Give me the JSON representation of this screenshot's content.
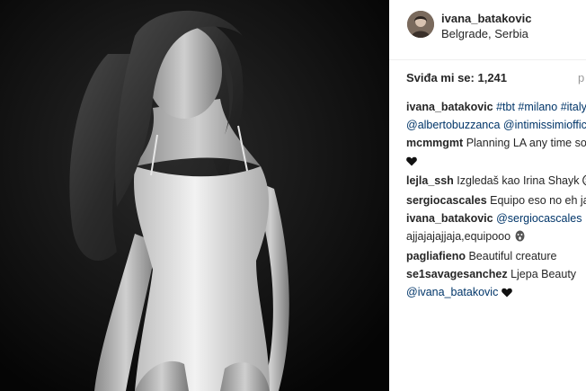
{
  "post": {
    "username": "ivana_batakovic",
    "location": "Belgrade, Serbia",
    "likes_label": "Sviđa mi se: 1,241",
    "date_partial": "p"
  },
  "comments": [
    {
      "user": "ivana_batakovic",
      "parts": [
        " ",
        {
          "link": "#tbt"
        },
        " ",
        {
          "link": "#milano"
        },
        " ",
        {
          "link": "#italy"
        }
      ]
    },
    {
      "user": "",
      "parts": [
        {
          "link": "@albertobuzzanca"
        },
        " ",
        {
          "link": "@intimissimiofficial"
        }
      ]
    },
    {
      "user": "mcmmgmt",
      "parts": [
        " Planning LA any time soon"
      ]
    },
    {
      "user": "",
      "parts": [
        {
          "emoji": "black-heart"
        }
      ]
    },
    {
      "user": "lejla_ssh",
      "parts": [
        " Izgledaš kao Irina Shayk ",
        {
          "emoji": "smile"
        }
      ]
    },
    {
      "user": "sergiocascales",
      "parts": [
        " Equipo eso no eh jajaja"
      ]
    },
    {
      "user": "ivana_batakovic",
      "parts": [
        " ",
        {
          "link": "@sergiocascales"
        }
      ]
    },
    {
      "user": "",
      "parts": [
        "ajjajajajjaja,equipooo ",
        {
          "emoji": "scream"
        }
      ]
    },
    {
      "user": "pagliafieno",
      "parts": [
        " Beautiful creature"
      ]
    },
    {
      "user": "se1savagesanchez",
      "parts": [
        " Ljepa Beauty"
      ]
    },
    {
      "user": "",
      "parts": [
        {
          "link": "@ivana_batakovic"
        },
        " ",
        {
          "emoji": "black-heart"
        }
      ]
    }
  ]
}
